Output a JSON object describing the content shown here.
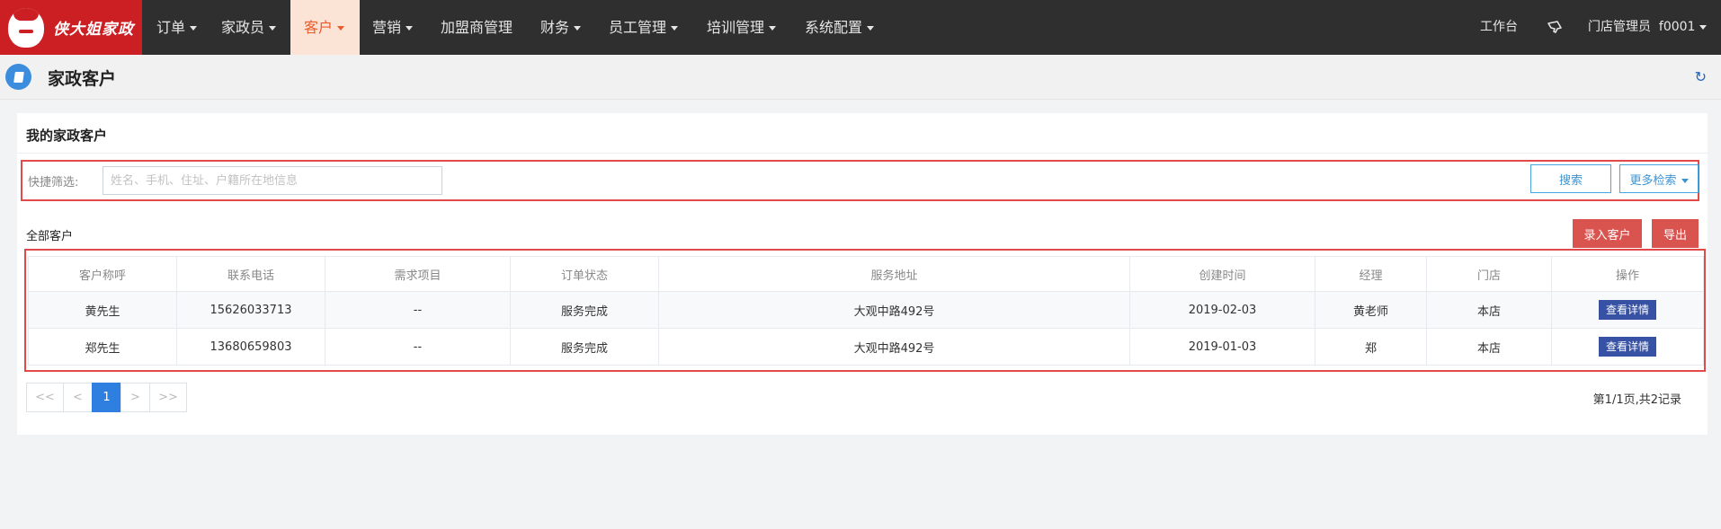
{
  "brand": {
    "logo_text": "侠大姐家政"
  },
  "nav": {
    "items": [
      {
        "label": "订单",
        "dropdown": true
      },
      {
        "label": "家政员",
        "dropdown": true
      },
      {
        "label": "客户",
        "dropdown": true,
        "active": true
      },
      {
        "label": "营销",
        "dropdown": true
      },
      {
        "label": "加盟商管理",
        "dropdown": false
      },
      {
        "label": "财务",
        "dropdown": true
      },
      {
        "label": "员工管理",
        "dropdown": true
      },
      {
        "label": "培训管理",
        "dropdown": true
      },
      {
        "label": "系统配置",
        "dropdown": true
      }
    ],
    "workbench": "工作台",
    "user": "门店管理员  f0001"
  },
  "page": {
    "title": "家政客户",
    "icon": "book-icon"
  },
  "card": {
    "title": "我的家政客户"
  },
  "filter": {
    "label": "快捷筛选:",
    "placeholder": "姓名、手机、住址、户籍所在地信息",
    "value": "",
    "search_label": "搜索",
    "more_label": "更多检索"
  },
  "list": {
    "section_label": "全部客户",
    "add_label": "录入客户",
    "export_label": "导出",
    "columns": [
      "客户称呼",
      "联系电话",
      "需求项目",
      "订单状态",
      "服务地址",
      "创建时间",
      "经理",
      "门店",
      "操作"
    ],
    "rows": [
      {
        "name": "黄先生",
        "phone": "15626033713",
        "need": "--",
        "status": "服务完成",
        "address": "大观中路492号",
        "created": "2019-02-03",
        "manager": "黄老师",
        "store": "本店",
        "action": "查看详情"
      },
      {
        "name": "郑先生",
        "phone": "13680659803",
        "need": "--",
        "status": "服务完成",
        "address": "大观中路492号",
        "created": "2019-01-03",
        "manager": "郑",
        "store": "本店",
        "action": "查看详情"
      }
    ]
  },
  "pagination": {
    "first": "<<",
    "prev": "<",
    "current": "1",
    "next": ">",
    "last": ">>",
    "info": "第1/1页,共2记录"
  },
  "colors": {
    "nav_bg": "#2f2f2f",
    "brand_red": "#cc1f24",
    "active_tab_bg": "#fbe3d6",
    "active_tab_text": "#e95b2a",
    "danger_button": "#d9534f",
    "detail_button": "#3752a5",
    "pager_active": "#2f7fe0",
    "highlight_border": "#e24a4a"
  }
}
